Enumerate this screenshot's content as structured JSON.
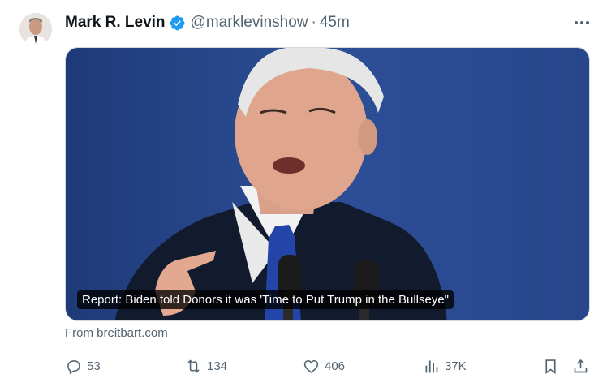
{
  "post": {
    "author_name": "Mark R. Levin",
    "handle": "@marklevinshow",
    "separator": "·",
    "timestamp": "45m",
    "media_caption": "Report: Biden told Donors it was 'Time to Put Trump in the Bullseye\"",
    "source": "From breitbart.com",
    "stats": {
      "replies": "53",
      "reposts": "134",
      "likes": "406",
      "views": "37K"
    }
  },
  "icons": {
    "verified": "verified-badge-icon",
    "more": "more-options-icon",
    "reply": "reply-icon",
    "repost": "repost-icon",
    "like": "heart-icon",
    "views": "analytics-icon",
    "bookmark": "bookmark-icon",
    "share": "share-icon"
  },
  "colors": {
    "verified": "#1d9bf0",
    "secondary_text": "#536471",
    "media_background": "#2b4a8a"
  }
}
